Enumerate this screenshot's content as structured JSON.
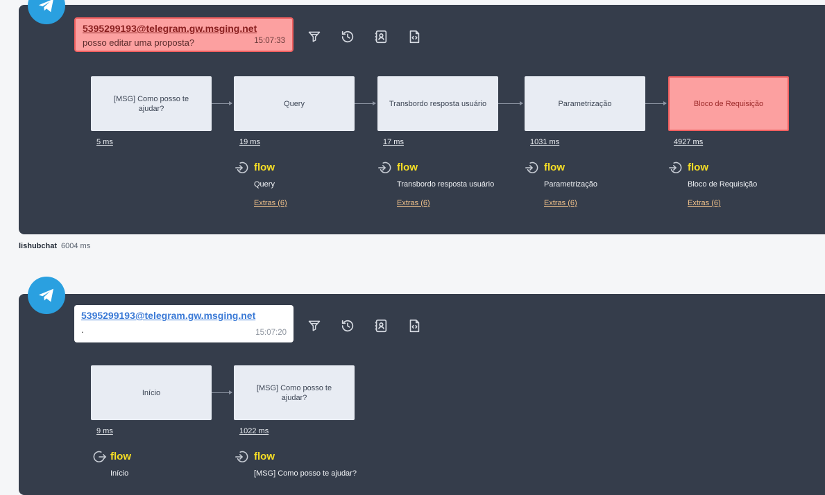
{
  "sessions": [
    {
      "bubble": {
        "address": "5395299193@telegram.gw.msging.net",
        "message": "posso editar uma proposta?",
        "time": "15:07:33",
        "style": "error"
      },
      "steps": [
        {
          "title": "[MSG] Como posso te ajudar?",
          "ms": "5 ms"
        },
        {
          "title": "Query",
          "ms": "19 ms",
          "flow_label": "flow",
          "flow_name": "Query",
          "extras": "Extras (6)"
        },
        {
          "title": "Transbordo resposta usuário",
          "ms": "17 ms",
          "flow_label": "flow",
          "flow_name": "Transbordo resposta usuário",
          "extras": "Extras (6)"
        },
        {
          "title": "Parametrização",
          "ms": "1031 ms",
          "flow_label": "flow",
          "flow_name": "Parametrização",
          "extras": "Extras (6)"
        },
        {
          "title": "Bloco de Requisição",
          "ms": "4927 ms",
          "flow_label": "flow",
          "flow_name": "Bloco de Requisição",
          "extras": "Extras (6)",
          "error": true
        }
      ]
    },
    {
      "bubble": {
        "address": "5395299193@telegram.gw.msging.net",
        "message": ".",
        "time": "15:07:20",
        "style": "normal"
      },
      "steps": [
        {
          "title": "Início",
          "ms": "9 ms",
          "flow_label": "flow",
          "flow_name": "Início"
        },
        {
          "title": "[MSG] Como posso te ajudar?",
          "ms": "1022 ms",
          "flow_label": "flow",
          "flow_name": "[MSG] Como posso te ajudar?"
        }
      ]
    }
  ],
  "summary": {
    "bot": "lishubchat",
    "total": "6004 ms"
  },
  "icons": [
    "telegram-icon",
    "filter-icon",
    "history-icon",
    "contact-icon",
    "code-file-icon",
    "flow-enter-icon",
    "flow-exit-icon"
  ],
  "colors": {
    "panel": "#353d4b",
    "accent": "#2aa0e0",
    "flow": "#f6de25",
    "error_bg": "#fca0a0",
    "error_border": "#ef5f5f"
  }
}
